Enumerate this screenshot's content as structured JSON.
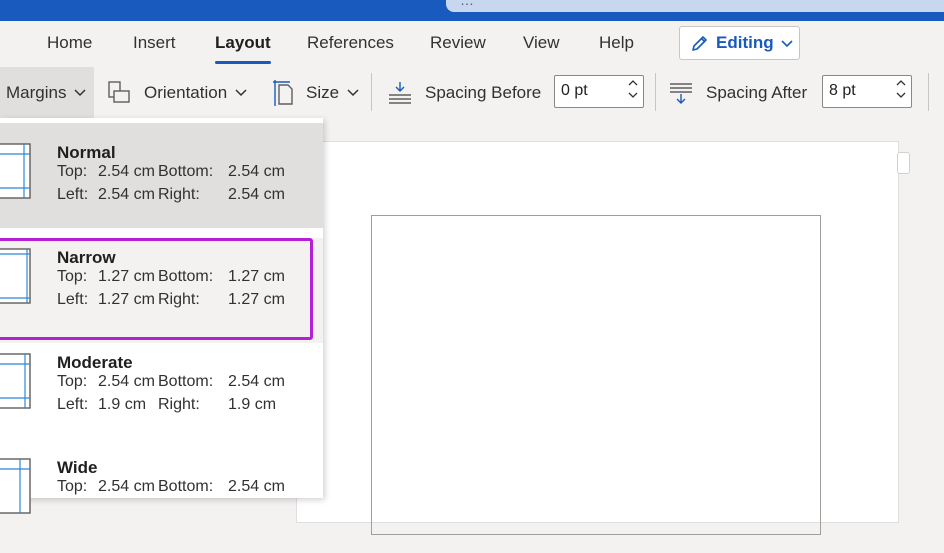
{
  "titlebar": {
    "search_fragment": "…"
  },
  "tabs": [
    {
      "label": "Home"
    },
    {
      "label": "Insert"
    },
    {
      "label": "Layout"
    },
    {
      "label": "References"
    },
    {
      "label": "Review"
    },
    {
      "label": "View"
    },
    {
      "label": "Help"
    }
  ],
  "active_tab": "Layout",
  "editing": {
    "label": "Editing",
    "icon": "pencil-icon"
  },
  "ribbon": {
    "margins_label": "Margins",
    "orientation_label": "Orientation",
    "size_label": "Size",
    "spacing_before_label": "Spacing Before",
    "spacing_before_value": "0 pt",
    "spacing_after_label": "Spacing After",
    "spacing_after_value": "8 pt"
  },
  "margins_menu": {
    "items": [
      {
        "name": "Normal",
        "top": "2.54 cm",
        "bottom": "2.54 cm",
        "left": "2.54 cm",
        "right": "2.54 cm"
      },
      {
        "name": "Narrow",
        "top": "1.27 cm",
        "bottom": "1.27 cm",
        "left": "1.27 cm",
        "right": "1.27 cm"
      },
      {
        "name": "Moderate",
        "top": "2.54 cm",
        "bottom": "2.54 cm",
        "left": "1.9 cm",
        "right": "1.9 cm"
      },
      {
        "name": "Wide",
        "top": "2.54 cm",
        "bottom": "2.54 cm"
      }
    ],
    "labels": {
      "top": "Top:",
      "bottom": "Bottom:",
      "left": "Left:",
      "right": "Right:"
    },
    "highlight_color": "#b51fd6"
  },
  "colors": {
    "accent": "#185abd",
    "highlight": "#b51fd6"
  }
}
